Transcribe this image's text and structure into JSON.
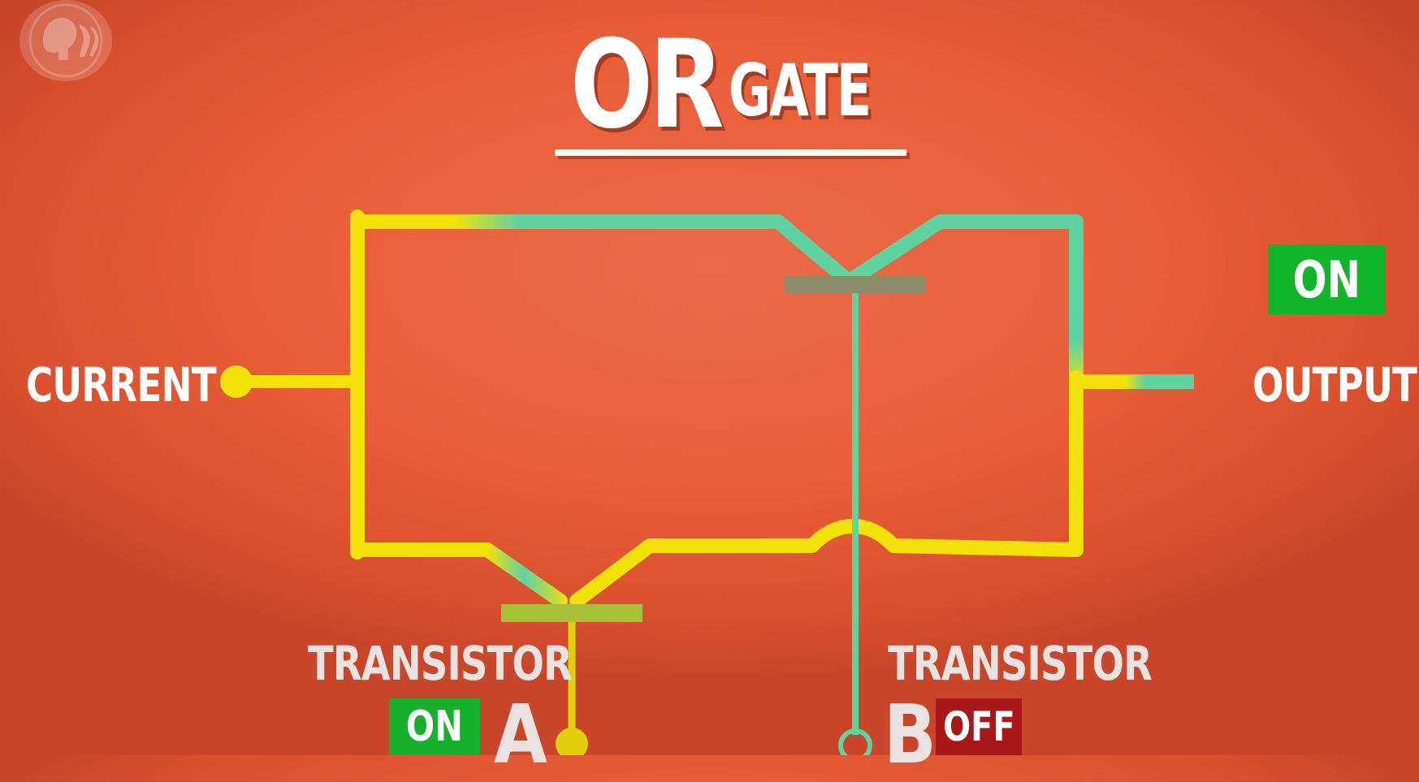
{
  "title": {
    "main": "OR",
    "sub": "GATE"
  },
  "labels": {
    "current": "CURRENT",
    "output": "OUTPUT",
    "transistor_a": "TRANSISTOR",
    "transistor_b": "TRANSISTOR",
    "letter_a": "A",
    "letter_b": "B"
  },
  "states": {
    "output": "ON",
    "transistor_a": "ON",
    "transistor_b": "OFF"
  },
  "logo": {
    "icon": "pbs-logo-icon"
  },
  "colors": {
    "background": "#e85d38",
    "wire_powered": "#f2e20a",
    "wire_unpowered": "#5ed3a0",
    "gate_a": "#a6c23a",
    "gate_b": "#8a8c6a",
    "badge_on": "#10b52a",
    "badge_off": "#a8171a",
    "text": "#ffffff"
  }
}
